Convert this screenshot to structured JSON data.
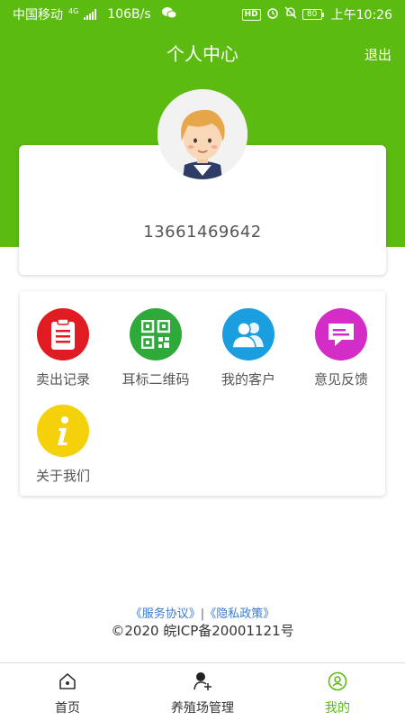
{
  "status_bar": {
    "carrier": "中国移动",
    "network": "4G",
    "speed": "106B/s",
    "hd_badge": "HD",
    "battery": "80",
    "time": "上午10:26"
  },
  "header": {
    "title": "个人中心",
    "logout_label": "退出"
  },
  "profile": {
    "phone": "13661469642"
  },
  "menu": {
    "items": [
      {
        "label": "卖出记录",
        "icon": "clipboard-icon",
        "color": "#e11b22"
      },
      {
        "label": "耳标二维码",
        "icon": "qrcode-icon",
        "color": "#2eaa3a"
      },
      {
        "label": "我的客户",
        "icon": "users-icon",
        "color": "#1a9ee0"
      },
      {
        "label": "意见反馈",
        "icon": "feedback-icon",
        "color": "#d42cc7"
      },
      {
        "label": "关于我们",
        "icon": "info-icon",
        "color": "#f5d10c"
      }
    ]
  },
  "footer": {
    "service_link": "《服务协议》",
    "separator": "|",
    "privacy_link": "《隐私政策》",
    "copyright": "©2020 皖ICP备20001121号"
  },
  "tabbar": {
    "tabs": [
      {
        "label": "首页",
        "icon": "home-icon"
      },
      {
        "label": "养殖场管理",
        "icon": "farm-user-icon"
      },
      {
        "label": "我的",
        "icon": "profile-icon",
        "active": true
      }
    ]
  },
  "colors": {
    "brand": "#5bbb10",
    "link": "#3a7bd5"
  }
}
